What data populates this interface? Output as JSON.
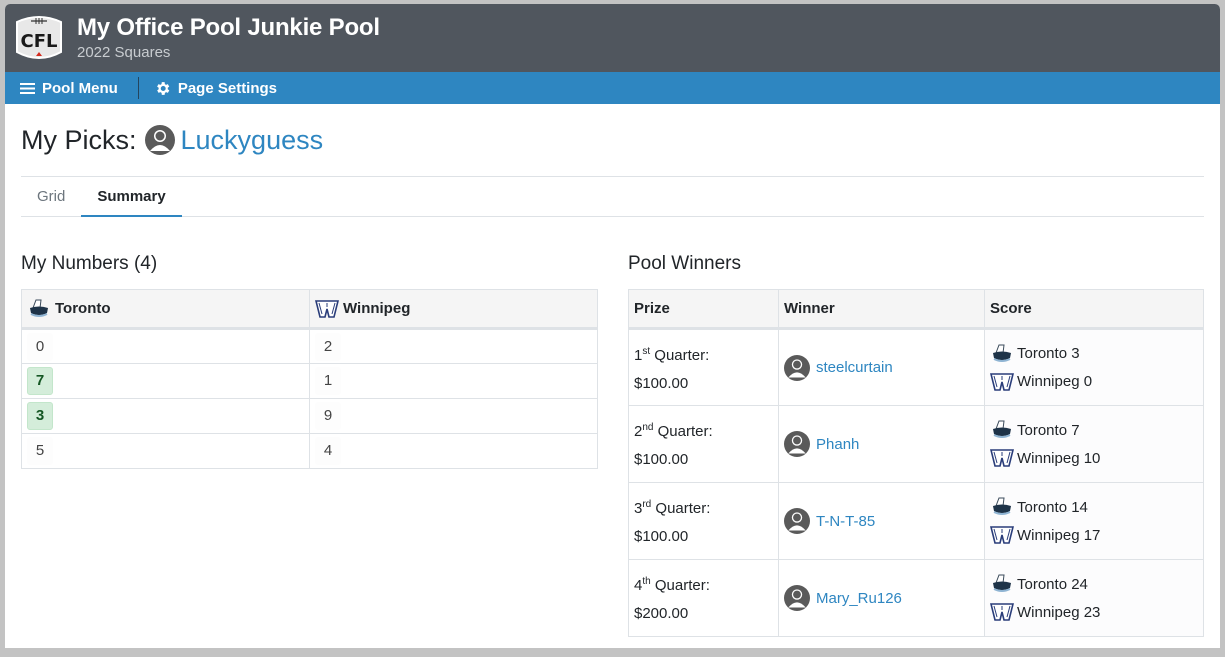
{
  "header": {
    "logo_text": "CFL",
    "title": "My Office Pool Junkie Pool",
    "subtitle": "2022 Squares"
  },
  "navbar": {
    "pool_menu": "Pool Menu",
    "page_settings": "Page Settings"
  },
  "page": {
    "title_prefix": "My Picks:",
    "username": "Luckyguess"
  },
  "tabs": [
    {
      "label": "Grid",
      "active": false
    },
    {
      "label": "Summary",
      "active": true
    }
  ],
  "my_numbers": {
    "heading": "My Numbers (4)",
    "columns": [
      "Toronto",
      "Winnipeg"
    ],
    "rows": [
      {
        "toronto": "0",
        "winnipeg": "2",
        "toronto_hit": false
      },
      {
        "toronto": "7",
        "winnipeg": "1",
        "toronto_hit": true
      },
      {
        "toronto": "3",
        "winnipeg": "9",
        "toronto_hit": true
      },
      {
        "toronto": "5",
        "winnipeg": "4",
        "toronto_hit": false
      }
    ]
  },
  "pool_winners": {
    "heading": "Pool Winners",
    "columns": [
      "Prize",
      "Winner",
      "Score"
    ],
    "rows": [
      {
        "num": "1",
        "suffix": "st",
        "period": "Quarter:",
        "amount": "$100.00",
        "winner": "steelcurtain",
        "home": "Toronto 3",
        "away": "Winnipeg 0"
      },
      {
        "num": "2",
        "suffix": "nd",
        "period": "Quarter:",
        "amount": "$100.00",
        "winner": "Phanh",
        "home": "Toronto 7",
        "away": "Winnipeg 10"
      },
      {
        "num": "3",
        "suffix": "rd",
        "period": "Quarter:",
        "amount": "$100.00",
        "winner": "T-N-T-85",
        "home": "Toronto 14",
        "away": "Winnipeg 17"
      },
      {
        "num": "4",
        "suffix": "th",
        "period": "Quarter:",
        "amount": "$200.00",
        "winner": "Mary_Ru126",
        "home": "Toronto 24",
        "away": "Winnipeg 23"
      }
    ]
  },
  "colors": {
    "header_bg": "#50565e",
    "navbar_bg": "#2e86c1",
    "link": "#2e86c1",
    "hit_bg": "#d4edda",
    "hit_text": "#155724"
  }
}
